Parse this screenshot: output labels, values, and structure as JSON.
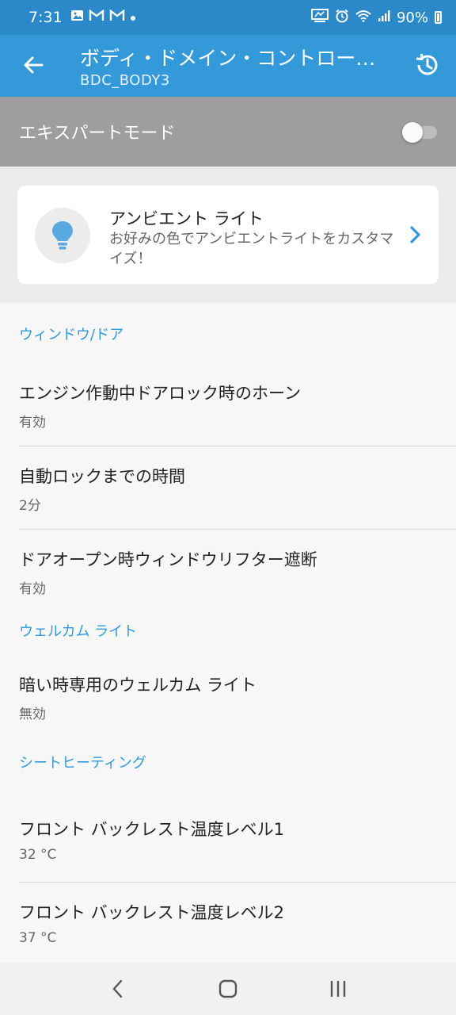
{
  "status_bar": {
    "time": "7:31",
    "notification_icons": [
      "image-icon",
      "gmail-icon",
      "gmail-icon",
      "dot-icon"
    ],
    "battery": "90%"
  },
  "app_bar": {
    "title": "ボディ・ドメイン・コントロー…",
    "subtitle": "BDC_BODY3"
  },
  "expert_mode": {
    "label": "エキスパートモード",
    "enabled": false
  },
  "banner": {
    "title": "アンビエント ライト",
    "description": "お好みの色でアンビエントライトをカスタマイズ！",
    "icon": "lightbulb-icon"
  },
  "sections": [
    {
      "header": "ウィンドウ/ドア",
      "items": [
        {
          "label": "エンジン作動中ドアロック時のホーン",
          "value": "有効"
        },
        {
          "label": "自動ロックまでの時間",
          "value": "2分"
        },
        {
          "label": "ドアオープン時ウィンドウリフター遮断",
          "value": "有効"
        }
      ]
    },
    {
      "header": "ウェルカム ライト",
      "items": [
        {
          "label": "暗い時専用のウェルカム ライト",
          "value": "無効"
        }
      ]
    },
    {
      "header": "シートヒーティング",
      "items": [
        {
          "label": "フロント バックレスト温度レベル1",
          "value": "32 °C"
        },
        {
          "label": "フロント バックレスト温度レベル2",
          "value": "37 °C"
        }
      ]
    }
  ],
  "colors": {
    "status_bar": "#2b89c9",
    "app_bar": "#3399d9",
    "accent": "#3399d9"
  }
}
